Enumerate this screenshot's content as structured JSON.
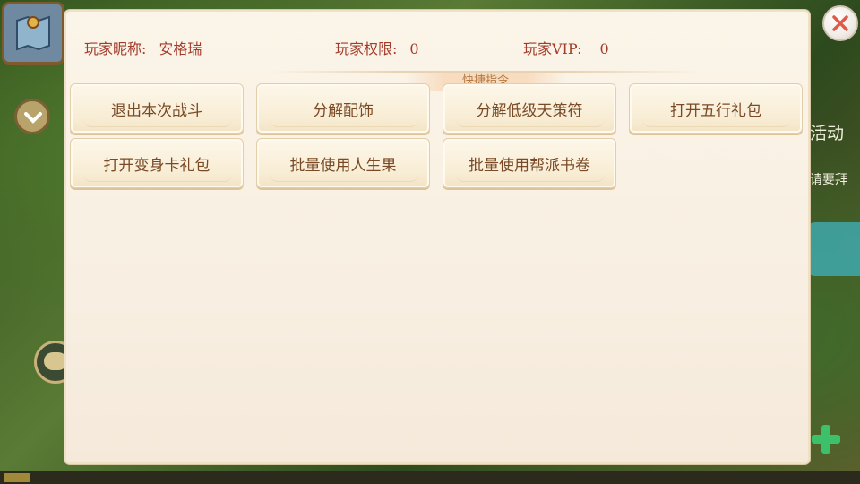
{
  "player": {
    "nickname_label": "玩家昵称:",
    "nickname_value": "安格瑞",
    "permission_label": "玩家权限:",
    "permission_value": "0",
    "vip_label": "玩家VIP:",
    "vip_value": "0"
  },
  "section": {
    "title": "快捷指令"
  },
  "commands": [
    {
      "label": "退出本次战斗"
    },
    {
      "label": "分解配饰"
    },
    {
      "label": "分解低级天策符"
    },
    {
      "label": "打开五行礼包"
    },
    {
      "label": "打开变身卡礼包"
    },
    {
      "label": "批量使用人生果"
    },
    {
      "label": "批量使用帮派书卷"
    }
  ],
  "background": {
    "right_text_1": "活动",
    "right_text_2": "请要拜"
  },
  "icons": {
    "close": "close-icon",
    "map": "map-icon",
    "chevron": "chevron-down-icon",
    "chat": "chat-icon",
    "plus": "plus-icon"
  },
  "colors": {
    "info_text": "#a33a2a",
    "button_text": "#7a4a26",
    "close_x": "#e05a4a"
  }
}
